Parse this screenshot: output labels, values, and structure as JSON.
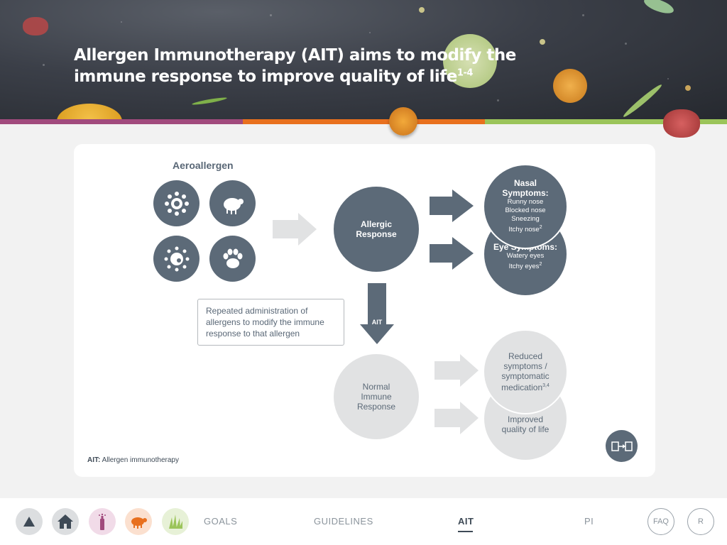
{
  "header": {
    "title": "Allergen Immunotherapy (AIT) aims to modify the immune response to improve quality of life",
    "title_sup": "1-4"
  },
  "diagram": {
    "aeroallergen_title": "Aeroallergen",
    "allergen_icons": [
      "pollen-icon",
      "dust-mite-icon",
      "mould-spore-icon",
      "pet-paw-icon"
    ],
    "allergic_response": "Allergic Response",
    "nasal": {
      "title": "Nasal Symptoms:",
      "items": [
        "Runny nose",
        "Blocked nose",
        "Sneezing",
        "Itchy nose"
      ],
      "last_sup": "2"
    },
    "eye": {
      "title": "Eye Symptoms:",
      "items": [
        "Watery eyes",
        "Itchy eyes"
      ],
      "last_sup": "2"
    },
    "ait_arrow_label": "AIT",
    "note": "Repeated administration of allergens to modify the immune response to that allergen",
    "normal_response": "Normal Immune Response",
    "reduced": {
      "text": "Reduced symptoms / symptomatic medication",
      "sup": "3,4"
    },
    "improved": "Improved quality of life"
  },
  "footnote": {
    "abbr": "AIT:",
    "text": "Allergen immunotherapy"
  },
  "colors": {
    "dark_circle": "#5c6a78",
    "light_circle": "#e1e2e3",
    "bar_purple": "#a14a7d",
    "bar_orange": "#e8701e",
    "bar_green": "#9bc45a"
  },
  "nav": {
    "icons": [
      "up-arrow-icon",
      "home-icon",
      "inhaler-icon",
      "dust-mite-icon",
      "grass-icon"
    ],
    "links": [
      "GOALS",
      "GUIDELINES",
      "AIT",
      "PI"
    ],
    "active": "AIT",
    "faq": "FAQ",
    "r": "R"
  }
}
